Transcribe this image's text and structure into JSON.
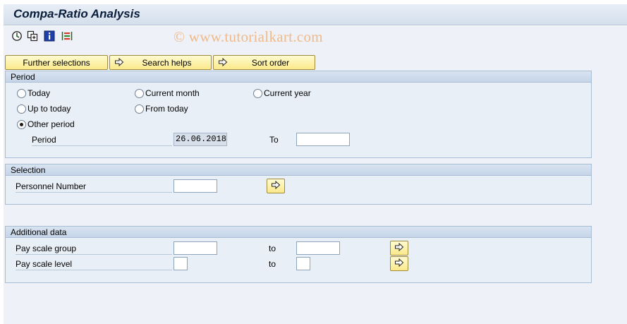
{
  "window": {
    "title": "Compa-Ratio Analysis"
  },
  "toolbar": {
    "icons": [
      "execute-icon",
      "get-variant-icon",
      "info-icon",
      "selection-options-icon"
    ]
  },
  "watermark": "© www.tutorialkart.com",
  "buttons": {
    "further_selections": "Further selections",
    "search_helps": "Search helps",
    "sort_order": "Sort order"
  },
  "period": {
    "header": "Period",
    "options": {
      "today": "Today",
      "current_month": "Current month",
      "current_year": "Current year",
      "up_to_today": "Up to today",
      "from_today": "From today",
      "other_period": "Other period"
    },
    "selected": "other_period",
    "period_label": "Period",
    "from_value": "26.06.2018",
    "to_label": "To",
    "to_value": ""
  },
  "selection": {
    "header": "Selection",
    "personnel_number_label": "Personnel Number",
    "personnel_number_value": ""
  },
  "additional": {
    "header": "Additional data",
    "pay_scale_group_label": "Pay scale group",
    "pay_scale_group_from": "",
    "pay_scale_group_to_label": "to",
    "pay_scale_group_to": "",
    "pay_scale_level_label": "Pay scale level",
    "pay_scale_level_from": "",
    "pay_scale_level_to_label": "to",
    "pay_scale_level_to": ""
  },
  "colors": {
    "button_fill": "#fbe98a",
    "group_background": "#e9eff7",
    "title_text": "#0a1d3a"
  }
}
